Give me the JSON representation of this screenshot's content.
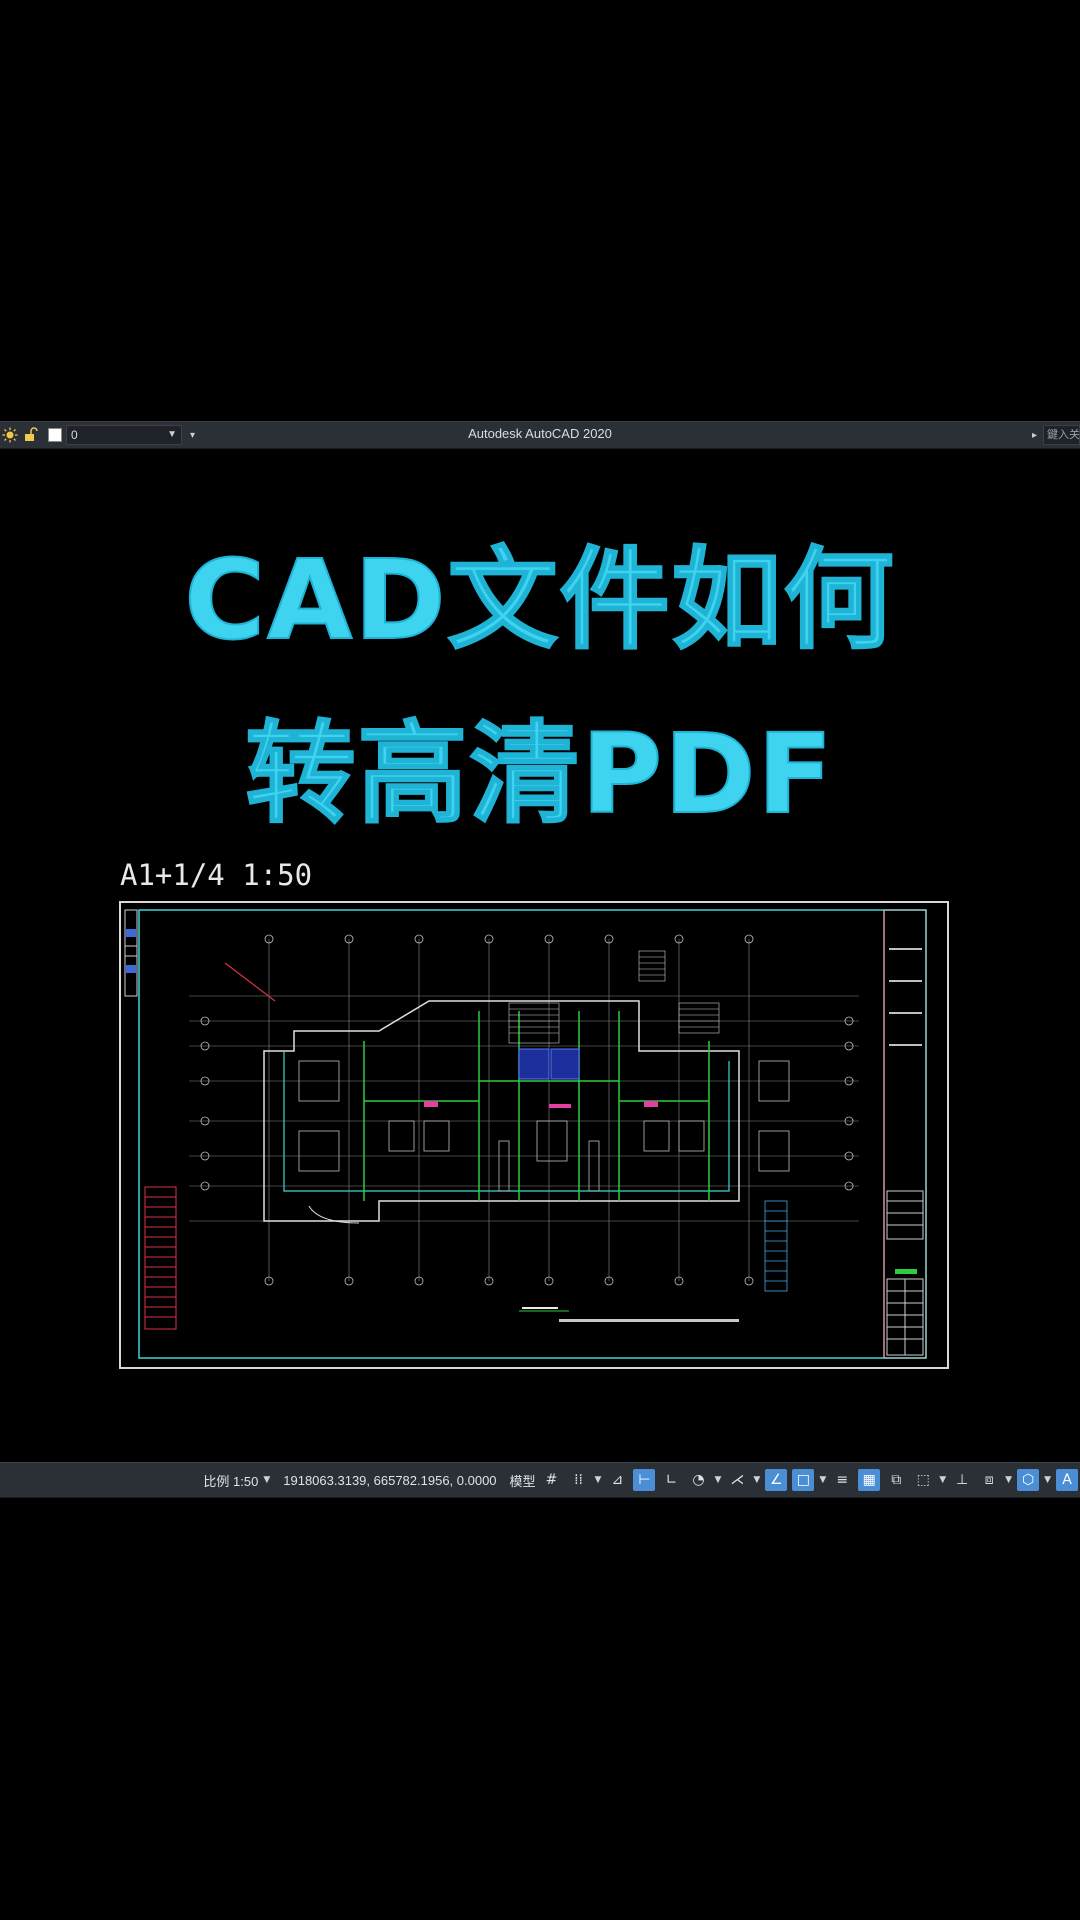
{
  "titlebar": {
    "layer_value": "0",
    "app_title": "Autodesk AutoCAD 2020",
    "search_placeholder": "鍵入关"
  },
  "headline": {
    "line1": "CAD文件如何",
    "line2": "转高清PDF"
  },
  "sheet": {
    "scale_label": "A1+1/4  1:50"
  },
  "statusbar": {
    "scale": "比例 1:50",
    "coordinates": "1918063.3139, 665782.1956, 0.0000",
    "model_label": "模型"
  },
  "colors": {
    "title_cyan": "#3ed3ef",
    "bar_bg": "#2b2f36",
    "active_blue": "#4a8ed6"
  }
}
